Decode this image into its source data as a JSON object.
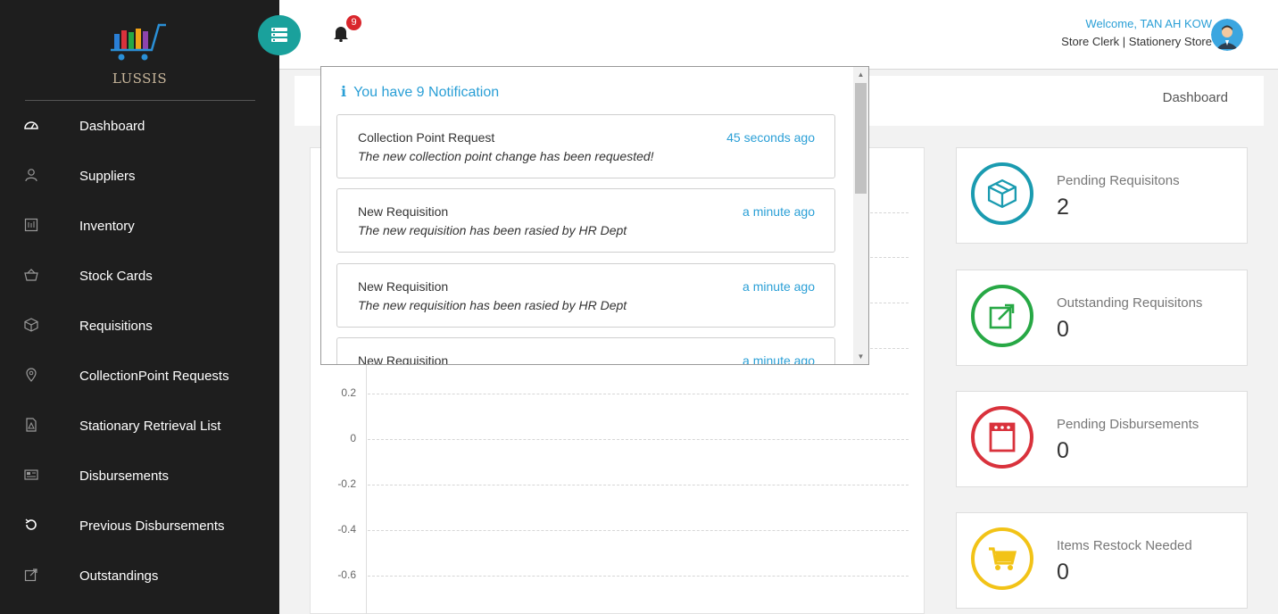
{
  "app": {
    "name": "LUSSIS"
  },
  "sidebar": {
    "items": [
      {
        "label": "Dashboard",
        "icon": "dashboard-icon"
      },
      {
        "label": "Suppliers",
        "icon": "user-icon"
      },
      {
        "label": "Inventory",
        "icon": "inventory-icon"
      },
      {
        "label": "Stock Cards",
        "icon": "basket-icon"
      },
      {
        "label": "Requisitions",
        "icon": "box-icon"
      },
      {
        "label": "CollectionPoint Requests",
        "icon": "location-pin-icon"
      },
      {
        "label": "Stationary Retrieval List",
        "icon": "pdf-file-icon"
      },
      {
        "label": "Disbursements",
        "icon": "newspaper-icon"
      },
      {
        "label": "Previous Disbursements",
        "icon": "history-icon"
      },
      {
        "label": "Outstandings",
        "icon": "external-link-icon"
      }
    ]
  },
  "header": {
    "notification_count": "9",
    "welcome": "Welcome, TAN AH KOW",
    "role": "Store Clerk | Stationery Store"
  },
  "breadcrumb": {
    "current": "Dashboard"
  },
  "notifications": {
    "heading": "You have 9 Notification",
    "items": [
      {
        "title": "Collection Point Request",
        "time": "45 seconds ago",
        "desc": "The new collection point change has been requested!"
      },
      {
        "title": "New Requisition",
        "time": "a minute ago",
        "desc": "The new requisition has been rasied by HR Dept"
      },
      {
        "title": "New Requisition",
        "time": "a minute ago",
        "desc": "The new requisition has been rasied by HR Dept"
      },
      {
        "title": "New Requisition",
        "time": "a minute ago",
        "desc": ""
      }
    ]
  },
  "chart_data": {
    "type": "line",
    "y_ticks": [
      "0.2",
      "0",
      "-0.2",
      "-0.4",
      "-0.6"
    ],
    "series": [],
    "grid": true
  },
  "cards": [
    {
      "title": "Pending Requisitons",
      "value": "2",
      "color": "#1a9bb0",
      "icon": "box-icon"
    },
    {
      "title": "Outstanding Requisitons",
      "value": "0",
      "color": "#27a845",
      "icon": "external-link-icon"
    },
    {
      "title": "Pending Disbursements",
      "value": "0",
      "color": "#d9323c",
      "icon": "calendar-icon"
    },
    {
      "title": "Items Restock Needed",
      "value": "0",
      "color": "#f2c317",
      "icon": "cart-icon"
    }
  ],
  "colors": {
    "sidebar_bg": "#1e1e1e",
    "accent": "#1aa19c",
    "link": "#2a9fd6",
    "badge": "#d9262c"
  }
}
